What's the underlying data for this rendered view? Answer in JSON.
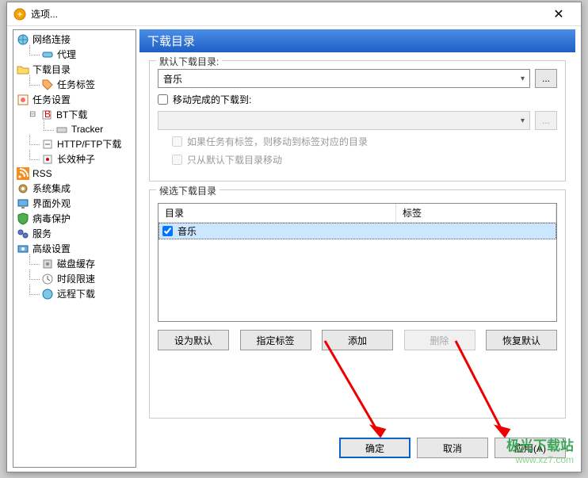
{
  "window": {
    "title": "选项..."
  },
  "tree": {
    "network": "网络连接",
    "proxy": "代理",
    "download_dir": "下载目录",
    "task_labels": "任务标签",
    "task_settings": "任务设置",
    "bt_download": "BT下载",
    "tracker": "Tracker",
    "http_ftp": "HTTP/FTP下载",
    "long_seed": "长效种子",
    "rss": "RSS",
    "system_integration": "系统集成",
    "ui_appearance": "界面外观",
    "virus_protection": "病毒保护",
    "services": "服务",
    "advanced": "高级设置",
    "disk_cache": "磁盘缓存",
    "time_limit": "时段限速",
    "remote_download": "远程下载"
  },
  "main": {
    "header": "下载目录",
    "default_group": {
      "legend": "默认下载目录:",
      "selected": "音乐",
      "browse": "...",
      "move_completed_label": "移动完成的下载到:",
      "move_completed_checked": false,
      "sub1": "如果任务有标签，则移动到标签对应的目录",
      "sub2": "只从默认下载目录移动"
    },
    "candidate_group": {
      "legend": "候选下载目录",
      "col_dir": "目录",
      "col_tag": "标签",
      "rows": [
        {
          "checked": true,
          "dir": "音乐",
          "tag": ""
        }
      ],
      "btn_default": "设为默认",
      "btn_label": "指定标签",
      "btn_add": "添加",
      "btn_delete": "删除",
      "btn_restore": "恢复默认"
    },
    "footer": {
      "ok": "确定",
      "cancel": "取消",
      "apply": "应用(A)"
    }
  },
  "watermark": {
    "cn": "极光下载站",
    "url": "www.xz7.com"
  }
}
